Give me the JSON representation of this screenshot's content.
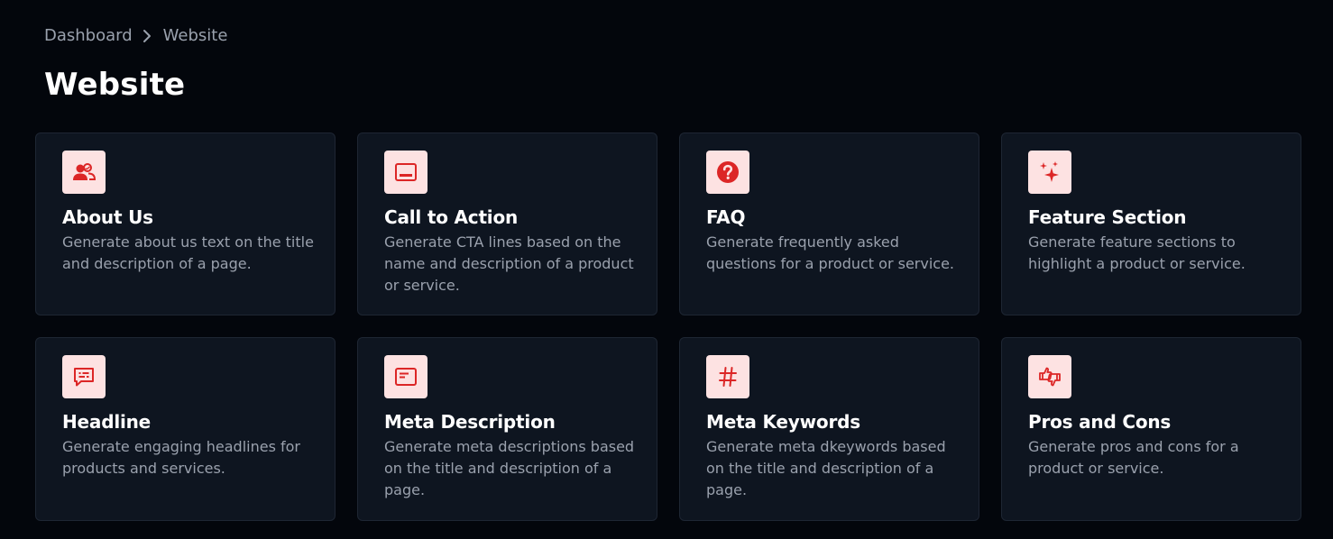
{
  "breadcrumb": {
    "items": [
      "Dashboard",
      "Website"
    ]
  },
  "page": {
    "title": "Website"
  },
  "colors": {
    "background": "#03060c",
    "card": "#0e1520",
    "icon_bg": "#fde2e2",
    "accent": "#dc2626"
  },
  "cards": [
    {
      "title": "About Us",
      "description": "Generate about us text on the title and description of a page.",
      "icon": "users-icon"
    },
    {
      "title": "Call to Action",
      "description": "Generate CTA lines based on the name and description of a product or service.",
      "icon": "window-bar-icon"
    },
    {
      "title": "FAQ",
      "description": "Generate frequently asked questions for a product or service.",
      "icon": "question-circle-icon"
    },
    {
      "title": "Feature Section",
      "description": "Generate feature sections to highlight a product or service.",
      "icon": "sparkles-icon"
    },
    {
      "title": "Headline",
      "description": "Generate engaging headlines for products and services.",
      "icon": "chat-text-icon"
    },
    {
      "title": "Meta Description",
      "description": "Generate meta descriptions based on the title and description of a page.",
      "icon": "browser-icon"
    },
    {
      "title": "Meta Keywords",
      "description": "Generate meta dkeywords based on the title and description of a page.",
      "icon": "hash-icon"
    },
    {
      "title": "Pros and Cons",
      "description": "Generate pros and cons for a product or service.",
      "icon": "thumbs-icon"
    }
  ]
}
